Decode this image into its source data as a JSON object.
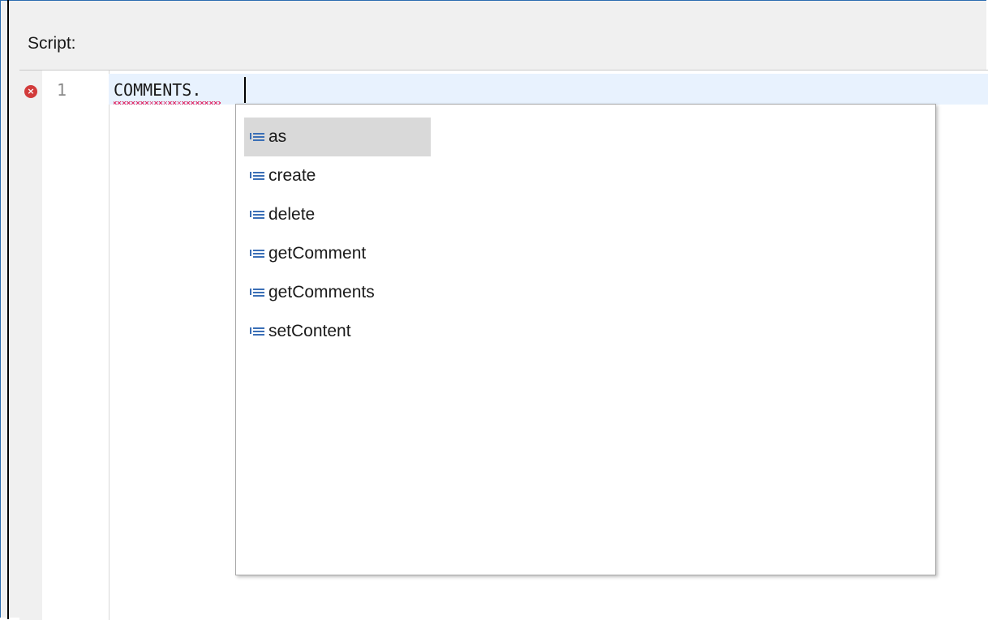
{
  "header": {
    "label": "Script:"
  },
  "editor": {
    "line_number": "1",
    "code": "COMMENTS."
  },
  "completion": {
    "items": [
      {
        "label": "as",
        "icon": "method-icon"
      },
      {
        "label": "create",
        "icon": "method-icon"
      },
      {
        "label": "delete",
        "icon": "method-icon"
      },
      {
        "label": "getComment",
        "icon": "method-icon"
      },
      {
        "label": "getComments",
        "icon": "method-icon"
      },
      {
        "label": "setContent",
        "icon": "method-icon"
      }
    ]
  },
  "colors": {
    "selection": "#d9d9d9",
    "current_line": "#e8f2fe",
    "error": "#d23b3b",
    "icon_blue": "#3b6fb6"
  }
}
